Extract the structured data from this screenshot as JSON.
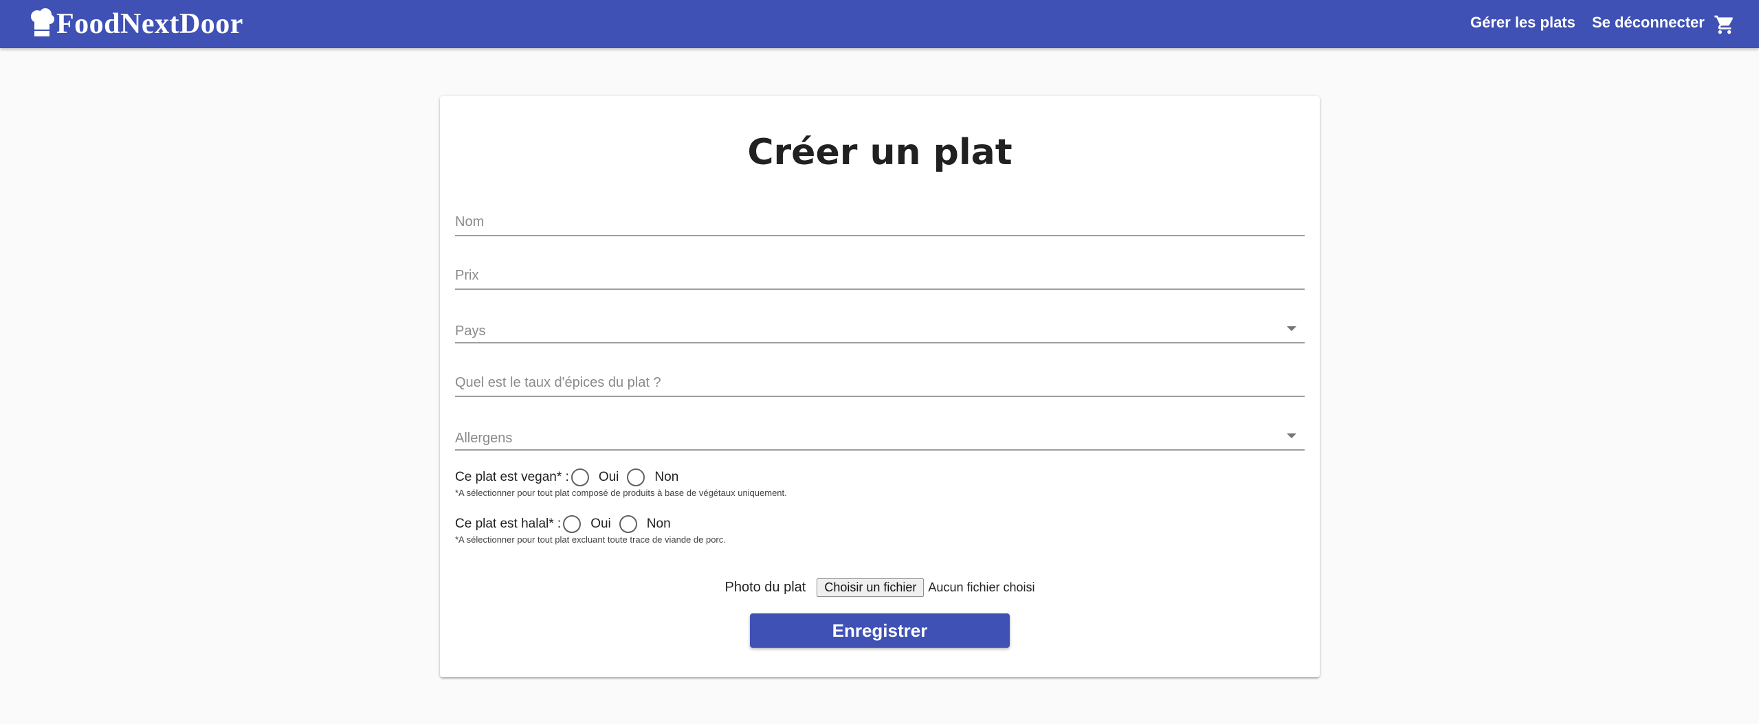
{
  "navbar": {
    "brand": "FoodNextDoor",
    "logo_icon": "chef-hat-icon",
    "links": {
      "manage": "Gérer les plats",
      "logout": "Se déconnecter"
    },
    "cart_icon": "shopping-cart-icon",
    "color": "#3f51b5"
  },
  "form": {
    "title": "Créer un plat",
    "name_placeholder": "Nom",
    "price_placeholder": "Prix",
    "country_label": "Pays",
    "spice_placeholder": "Quel est le taux d'épices du plat ?",
    "allergens_label": "Allergens",
    "vegan": {
      "label": "Ce plat est vegan* :",
      "yes": "Oui",
      "no": "Non",
      "hint": "*A sélectionner pour tout plat composé de produits à base de végétaux uniquement."
    },
    "halal": {
      "label": "Ce plat est halal* :",
      "yes": "Oui",
      "no": "Non",
      "hint": "*A sélectionner pour tout plat excluant toute trace de viande de porc."
    },
    "photo": {
      "label": "Photo du plat",
      "button": "Choisir un fichier",
      "status": "Aucun fichier choisi"
    },
    "submit": "Enregistrer"
  }
}
